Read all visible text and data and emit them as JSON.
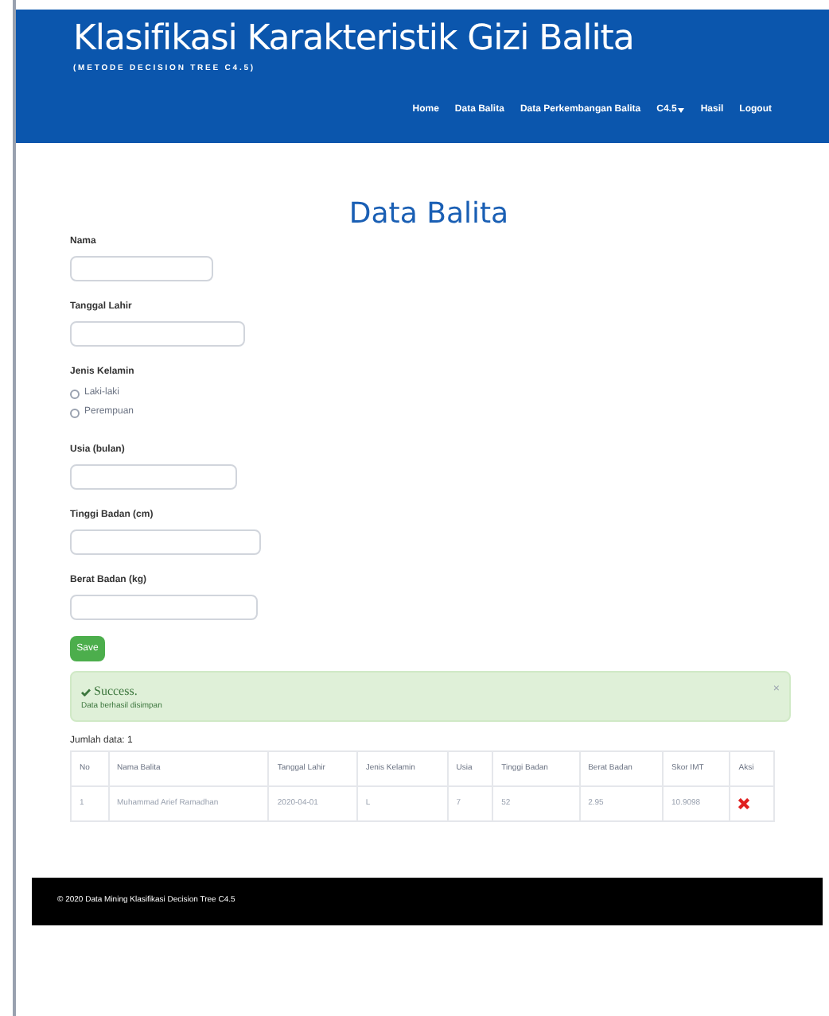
{
  "header": {
    "title": "Klasifikasi Karakteristik Gizi Balita",
    "subtitle": "( M E T O D E   D E C I S I O N   T R E E   C 4 . 5 )"
  },
  "nav": [
    {
      "label": "Home",
      "dropdown": false
    },
    {
      "label": "Data Balita",
      "dropdown": false
    },
    {
      "label": "Data Perkembangan Balita",
      "dropdown": false
    },
    {
      "label": "C4.5",
      "dropdown": true
    },
    {
      "label": "Hasil",
      "dropdown": false
    },
    {
      "label": "Logout",
      "dropdown": false
    }
  ],
  "page_title": "Data Balita",
  "form": {
    "fields": [
      {
        "kind": "text",
        "label": "Nama"
      },
      {
        "kind": "text",
        "label": "Tanggal Lahir"
      },
      {
        "kind": "radio",
        "label": "Jenis Kelamin",
        "options": [
          {
            "label": "Laki-laki",
            "selected": false
          },
          {
            "label": "Perempuan",
            "selected": false
          }
        ]
      },
      {
        "kind": "text",
        "label": "Usia (bulan)"
      },
      {
        "kind": "text",
        "label": "Tinggi Badan (cm)"
      },
      {
        "kind": "text",
        "label": "Berat Badan (kg)"
      }
    ],
    "submit": "Save"
  },
  "alert": {
    "title": "Success.",
    "message": "Data berhasil disimpan",
    "close": "×"
  },
  "count": "Jumlah data: 1",
  "table": {
    "columns": [
      "No",
      "Nama Balita",
      "Tanggal Lahir",
      "Jenis Kelamin",
      "Usia",
      "Tinggi Badan",
      "Berat Badan",
      "Skor IMT",
      "Aksi"
    ],
    "rows": [
      [
        "1",
        "Muhammad Arief Ramadhan",
        "2020-04-01",
        "L",
        "7",
        "52",
        "2.95",
        "10.9098"
      ]
    ]
  },
  "footer": "© 2020 Data Mining Klasifikasi Decision Tree C4.5"
}
